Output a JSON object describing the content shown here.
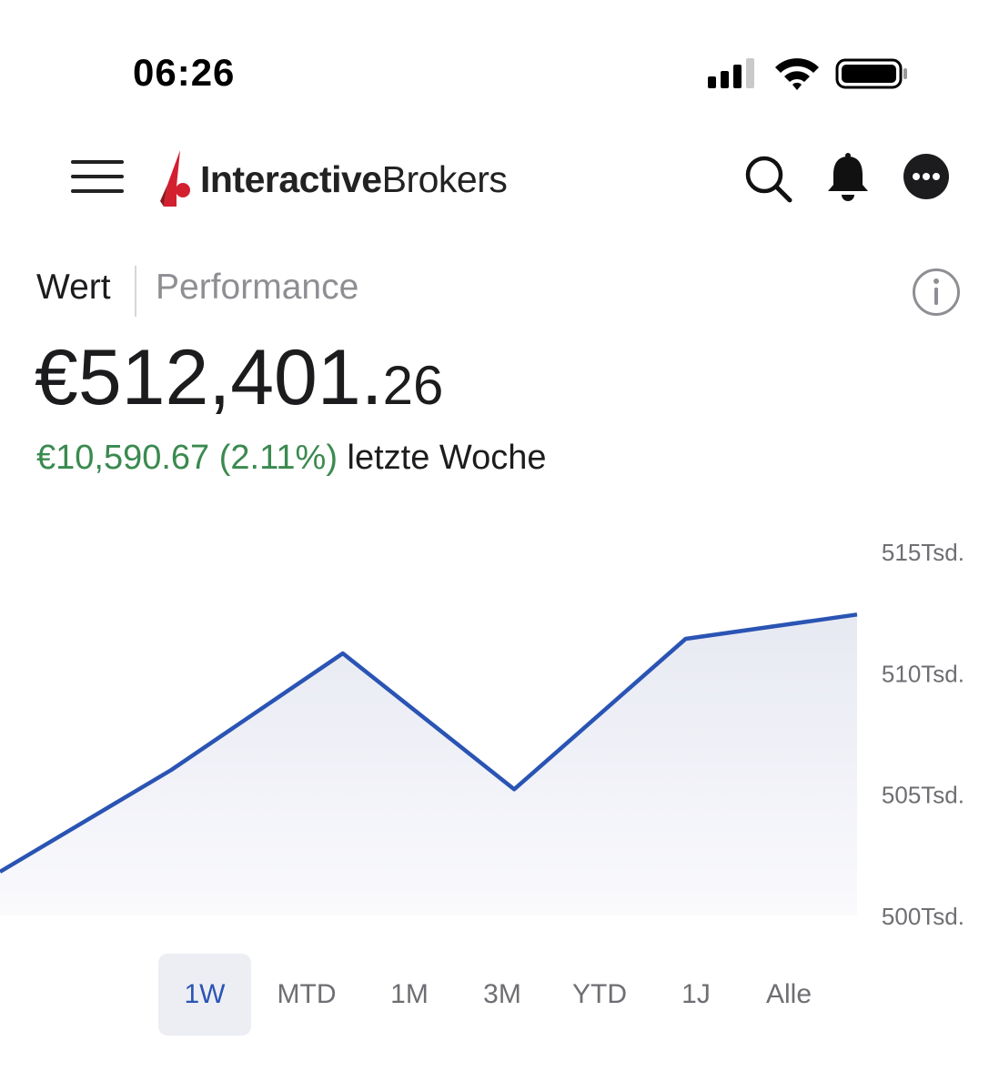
{
  "status_bar": {
    "time": "06:26"
  },
  "header": {
    "logo_text_bold": "Interactive",
    "logo_text_regular": "Brokers",
    "icons": [
      "menu-icon",
      "search-icon",
      "bell-icon",
      "more-icon"
    ]
  },
  "tabs": {
    "wert": "Wert",
    "performance": "Performance"
  },
  "portfolio": {
    "value_int": "€512,401.",
    "value_dec": "26",
    "change_amount": "€10,590.67 (2.11%)",
    "change_period": "letzte Woche"
  },
  "colors": {
    "accent": "#2a54b4",
    "positive": "#3a8a4f",
    "brand_red": "#d3202f",
    "chart_fill": "#eceef5"
  },
  "chart_data": {
    "type": "area",
    "x": [
      0,
      1,
      2,
      3,
      4,
      5
    ],
    "values": [
      501800,
      506000,
      510800,
      505200,
      511400,
      512400
    ],
    "ylim": [
      500000,
      515000
    ],
    "y_ticks": [
      {
        "value": 515000,
        "label": "515Tsd."
      },
      {
        "value": 510000,
        "label": "510Tsd."
      },
      {
        "value": 505000,
        "label": "505Tsd."
      },
      {
        "value": 500000,
        "label": "500Tsd."
      }
    ],
    "grid": false
  },
  "ranges": [
    "1W",
    "MTD",
    "1M",
    "3M",
    "YTD",
    "1J",
    "Alle"
  ],
  "selected_range": "1W"
}
